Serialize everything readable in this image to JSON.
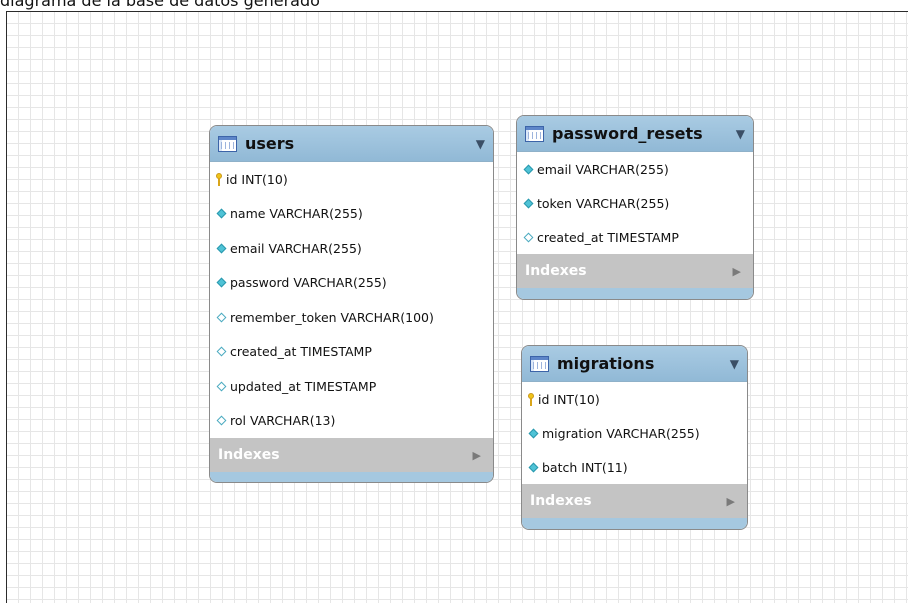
{
  "top_text": "diagrama de la base de datos generado",
  "entities": {
    "users": {
      "title": "users",
      "columns": [
        {
          "text": "id INT(10)",
          "icon": "primary-key-icon"
        },
        {
          "text": "name VARCHAR(255)",
          "icon": "not-null-column-icon"
        },
        {
          "text": "email VARCHAR(255)",
          "icon": "not-null-column-icon"
        },
        {
          "text": "password VARCHAR(255)",
          "icon": "not-null-column-icon"
        },
        {
          "text": "remember_token VARCHAR(100)",
          "icon": "nullable-column-icon"
        },
        {
          "text": "created_at TIMESTAMP",
          "icon": "nullable-column-icon"
        },
        {
          "text": "updated_at TIMESTAMP",
          "icon": "nullable-column-icon"
        },
        {
          "text": "rol VARCHAR(13)",
          "icon": "nullable-column-icon"
        }
      ],
      "indexes_label": "Indexes"
    },
    "password_resets": {
      "title": "password_resets",
      "columns": [
        {
          "text": "email VARCHAR(255)",
          "icon": "not-null-column-icon"
        },
        {
          "text": "token VARCHAR(255)",
          "icon": "not-null-column-icon"
        },
        {
          "text": "created_at TIMESTAMP",
          "icon": "nullable-column-icon"
        }
      ],
      "indexes_label": "Indexes"
    },
    "migrations": {
      "title": "migrations",
      "columns": [
        {
          "text": "id INT(10)",
          "icon": "primary-key-icon"
        },
        {
          "text": "migration VARCHAR(255)",
          "icon": "not-null-column-icon"
        },
        {
          "text": "batch INT(11)",
          "icon": "not-null-column-icon"
        }
      ],
      "indexes_label": "Indexes"
    }
  },
  "colors": {
    "header": "#9fc4de",
    "indexes_bar": "#c4c4c4",
    "key": "#f0c419",
    "column_diamond": "#4fc3d6"
  }
}
